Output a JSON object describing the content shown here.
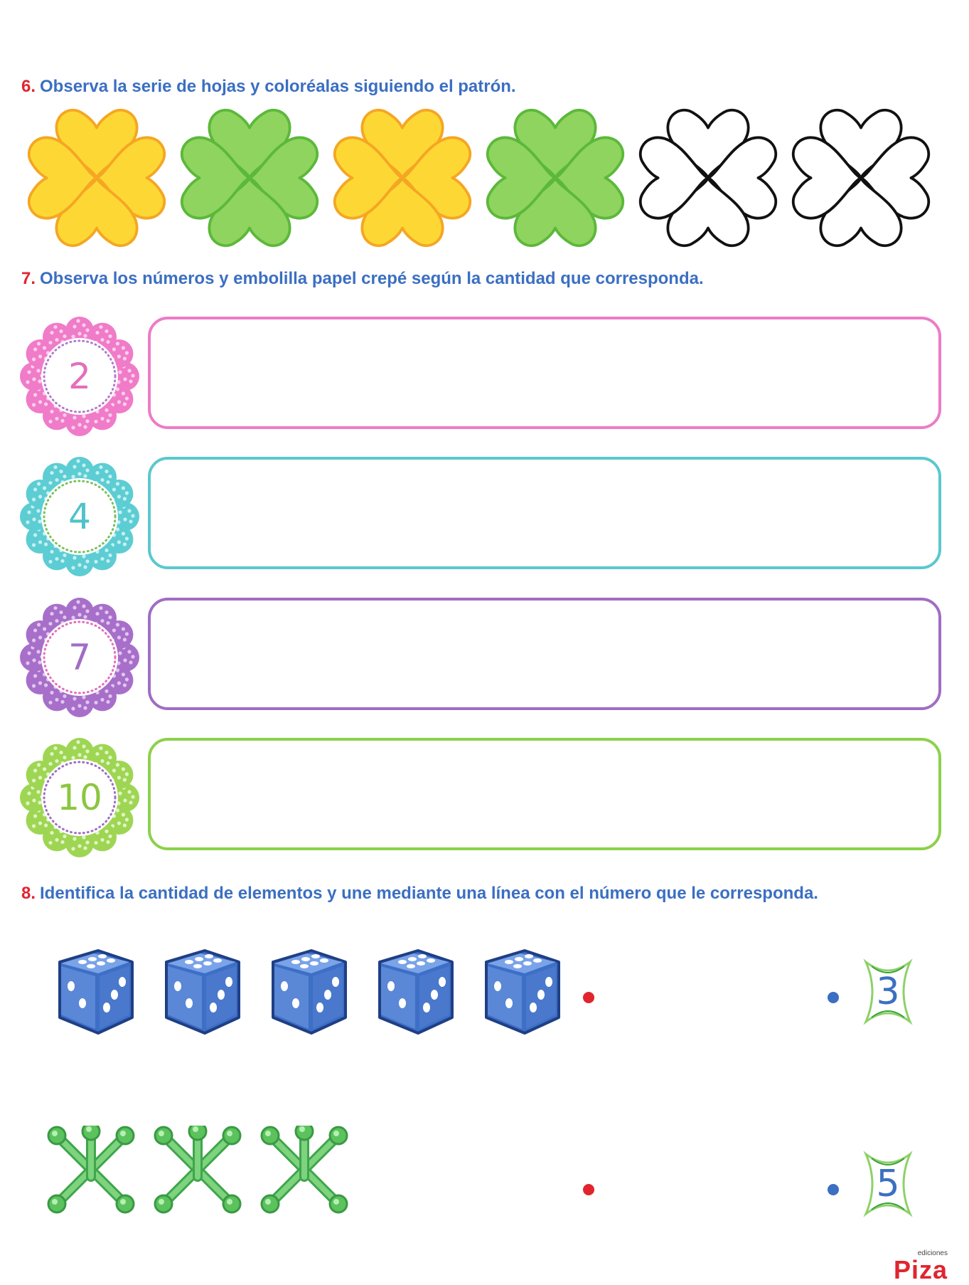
{
  "q6": {
    "number": "6.",
    "text": "Observa la serie de hojas y coloréalas siguiendo el patrón."
  },
  "q7": {
    "number": "7.",
    "text": "Observa los números y embolilla papel crepé según la cantidad que corresponda."
  },
  "q8": {
    "number": "8.",
    "text": "Identifica la cantidad de elementos y une mediante una línea con el número que le corresponda."
  },
  "clovers": [
    {
      "fill": "#fdd835",
      "stroke": "#f5a623"
    },
    {
      "fill": "#8fd45f",
      "stroke": "#5cb83a"
    },
    {
      "fill": "#fdd835",
      "stroke": "#f5a623"
    },
    {
      "fill": "#8fd45f",
      "stroke": "#5cb83a"
    },
    {
      "fill": "#ffffff",
      "stroke": "#111111"
    },
    {
      "fill": "#ffffff",
      "stroke": "#111111"
    }
  ],
  "flowers": [
    {
      "label": "2",
      "petal": "#f07bc8",
      "spot": "#fbd0ec",
      "ring": "#b07bd0",
      "text": "#e36fbd",
      "box": "#ee7bc7"
    },
    {
      "label": "4",
      "petal": "#5ccdd3",
      "spot": "#c8f0f2",
      "ring": "#7bc05b",
      "text": "#4fc3c9",
      "box": "#5ac8ce"
    },
    {
      "label": "7",
      "petal": "#a76fc9",
      "spot": "#e1c7f0",
      "ring": "#e36fbd",
      "text": "#a06dc5",
      "box": "#a06dc5"
    },
    {
      "label": "10",
      "petal": "#9ed653",
      "spot": "#e2f5c8",
      "ring": "#a06dc5",
      "text": "#8cc63f",
      "box": "#8cd14a"
    }
  ],
  "matching": {
    "dice_count": 5,
    "jacks_count": 3,
    "left_dot_color": "#e0252f",
    "right_dot_color": "#3b6fc2",
    "numbers": [
      "3",
      "5"
    ]
  },
  "logo": {
    "small": "ediciones",
    "brand": "Piza"
  }
}
